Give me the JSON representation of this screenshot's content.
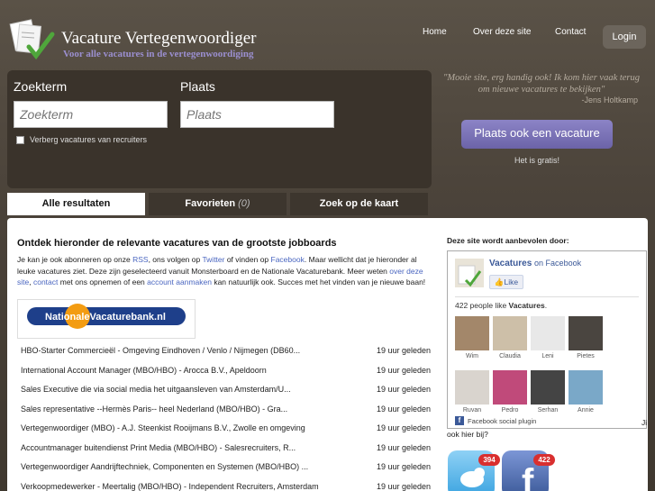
{
  "header": {
    "title": "Vacature Vertegenwoordiger",
    "subtitle": "Voor alle vacatures in de vertegenwoordiging",
    "nav": [
      "Home",
      "Over deze site",
      "Contact"
    ],
    "login": "Login"
  },
  "search": {
    "term_label": "Zoekterm",
    "term_placeholder": "Zoekterm",
    "place_label": "Plaats",
    "place_placeholder": "Plaats",
    "hide_recruiters": "Verberg vacatures van recruiters"
  },
  "testimonial": {
    "quote": "\"Mooie site, erg handig ook! Ik kom hier vaak terug om nieuwe vacatures te bekijken\"",
    "author": "-Jens Holtkamp"
  },
  "post": {
    "button": "Plaats ook een vacature",
    "note": "Het is gratis!"
  },
  "tabs": {
    "all": "Alle resultaten",
    "favorites": "Favorieten",
    "favorites_count": "(0)",
    "map": "Zoek op de kaart"
  },
  "main": {
    "heading": "Ontdek hieronder de relevante vacatures van de grootste jobboards",
    "intro": {
      "p1": "Je kan je ook abonneren op onze ",
      "rss": "RSS",
      "p2": ", ons volgen op ",
      "twitter": "Twitter",
      "p3": " of vinden op ",
      "facebook": "Facebook",
      "p4": ". Maar wellicht dat je hieronder al leuke vacatures ziet. Deze zijn geselecteerd vanuit Monsterboard en de Nationale Vacaturebank. Meer weten ",
      "about": "over deze site",
      "p5": ", ",
      "contact": "contact",
      "p6": " met ons opnemen of een ",
      "account": "account aanmaken",
      "p7": " kan natuurlijk ook. Succes met het vinden van je nieuwe baan!"
    },
    "source_logo": "NationaleVacaturebank.nl",
    "jobs": [
      {
        "title": "HBO-Starter Commercieël - Omgeving Eindhoven / Venlo / Nijmegen (DB60...",
        "time": "19 uur geleden"
      },
      {
        "title": "International Account Manager (MBO/HBO) - Arocca B.V., Apeldoorn",
        "time": "19 uur geleden"
      },
      {
        "title": "Sales Executive die via social media het uitgaansleven van Amsterdam/U...",
        "time": "19 uur geleden"
      },
      {
        "title": "Sales representative --Hermès Paris-- heel Nederland (MBO/HBO) - Gra...",
        "time": "19 uur geleden"
      },
      {
        "title": "Vertegenwoordiger (MBO) - A.J. Steenkist Rooijmans B.V., Zwolle en omgeving",
        "time": "19 uur geleden"
      },
      {
        "title": "Accountmanager buitendienst Print Media (MBO/HBO) - Salesrecruiters, R...",
        "time": "19 uur geleden"
      },
      {
        "title": "Vertegenwoordiger Aandrijftechniek, Componenten en Systemen (MBO/HBO) ...",
        "time": "19 uur geleden"
      },
      {
        "title": "Verkoopmedewerker - Meertalig (MBO/HBO) - Independent Recruiters, Amsterdam",
        "time": "19 uur geleden"
      }
    ]
  },
  "sidebar": {
    "heading": "Deze site wordt aanbevolen door:",
    "fb_page": "Vacatures",
    "fb_on": "on Facebook",
    "like": "Like",
    "count_text": "422 people like ",
    "count_page": "Vacatures",
    "count_end": ".",
    "fans": [
      "Wim",
      "Claudia",
      "Leni",
      "Pietes",
      "Ruvan",
      "Pedro",
      "Serhan",
      "Annie"
    ],
    "plugin": "Facebook social plugin",
    "more": "ook hier bij?",
    "more_prefix": "Ji",
    "twitter_count": "394",
    "facebook_count": "422"
  },
  "colors": {
    "accent": "#7d74bb",
    "fb": "#3b5998",
    "twitter": "#55acee",
    "badge": "#d92f2f"
  }
}
